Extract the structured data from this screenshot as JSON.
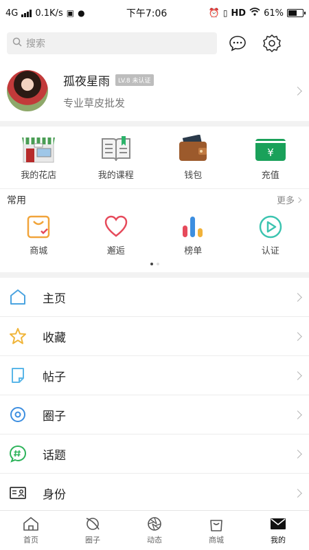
{
  "status_bar": {
    "network": "4G",
    "speed": "0.1K/s",
    "time": "下午7:06",
    "hd": "HD",
    "battery_percent": "61%",
    "battery_level": 0.61
  },
  "search": {
    "placeholder": "搜索"
  },
  "profile": {
    "name": "孤夜星雨",
    "level": "LV.8",
    "verify": "未认证",
    "subtitle": "专业草皮批发"
  },
  "quick_grid": [
    {
      "label": "我的花店",
      "icon": "flower-shop-icon"
    },
    {
      "label": "我的课程",
      "icon": "course-book-icon"
    },
    {
      "label": "钱包",
      "icon": "wallet-icon"
    },
    {
      "label": "充值",
      "icon": "recharge-icon",
      "symbol": "¥"
    }
  ],
  "common": {
    "title": "常用",
    "more": "更多",
    "items": [
      {
        "label": "商城",
        "icon": "shopping-bag-icon"
      },
      {
        "label": "邂逅",
        "icon": "heart-icon"
      },
      {
        "label": "榜单",
        "icon": "ranking-bars-icon"
      },
      {
        "label": "认证",
        "icon": "play-circle-icon"
      }
    ]
  },
  "menu": [
    {
      "label": "主页",
      "icon": "home-icon"
    },
    {
      "label": "收藏",
      "icon": "star-icon"
    },
    {
      "label": "帖子",
      "icon": "post-icon"
    },
    {
      "label": "圈子",
      "icon": "circle-icon"
    },
    {
      "label": "话题",
      "icon": "topic-hash-icon"
    },
    {
      "label": "身份",
      "icon": "id-card-icon"
    }
  ],
  "tabs": [
    {
      "label": "首页",
      "icon": "home-tab-icon"
    },
    {
      "label": "圈子",
      "icon": "orbit-tab-icon"
    },
    {
      "label": "动态",
      "icon": "aperture-tab-icon"
    },
    {
      "label": "商城",
      "icon": "bag-tab-icon"
    },
    {
      "label": "我的",
      "icon": "mail-tab-icon",
      "active": true
    }
  ],
  "colors": {
    "heart": "#e64a5b",
    "bag": "#f1a43a",
    "play": "#3cc4b0",
    "recharge": "#1aa15a",
    "wallet": "#9c5a2c",
    "star": "#f0b53a",
    "home": "#4aa3e0",
    "topic": "#2db35a"
  }
}
